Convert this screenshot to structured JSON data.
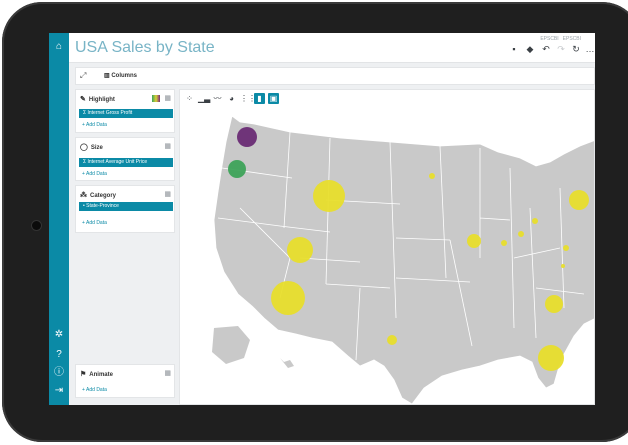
{
  "header": {
    "title": "USA Sales by State",
    "hints": [
      "EPSCBI",
      "EPSCBI"
    ]
  },
  "toolbar": {
    "columns_label": "Columns"
  },
  "panels": {
    "highlight": {
      "label": "Highlight",
      "field": "Internet Gross Profit",
      "add": "+ Add Data"
    },
    "size": {
      "label": "Size",
      "field": "Internet Average Unit Price",
      "add": "+ Add Data"
    },
    "category": {
      "label": "Category",
      "field": "State-Province",
      "add": "+ Add Data"
    },
    "animate": {
      "label": "Animate",
      "add": "+ Add Data"
    }
  },
  "colors": {
    "accent": "#0b8aa6",
    "title": "#78b4c6",
    "bubble_yellow": "#e8de2c",
    "bubble_purple": "#6a2c75",
    "bubble_green": "#3ea35a",
    "land": "#c9c9c9"
  },
  "icons": {
    "nav": [
      "home-icon",
      "gear-icon",
      "help-icon",
      "info-icon",
      "logout-icon"
    ],
    "chart_types": [
      "scatter-icon",
      "bar-chart-icon",
      "line-chart-icon",
      "pie-chart-icon",
      "grid-chart-icon",
      "map-icon",
      "image-icon"
    ]
  }
}
